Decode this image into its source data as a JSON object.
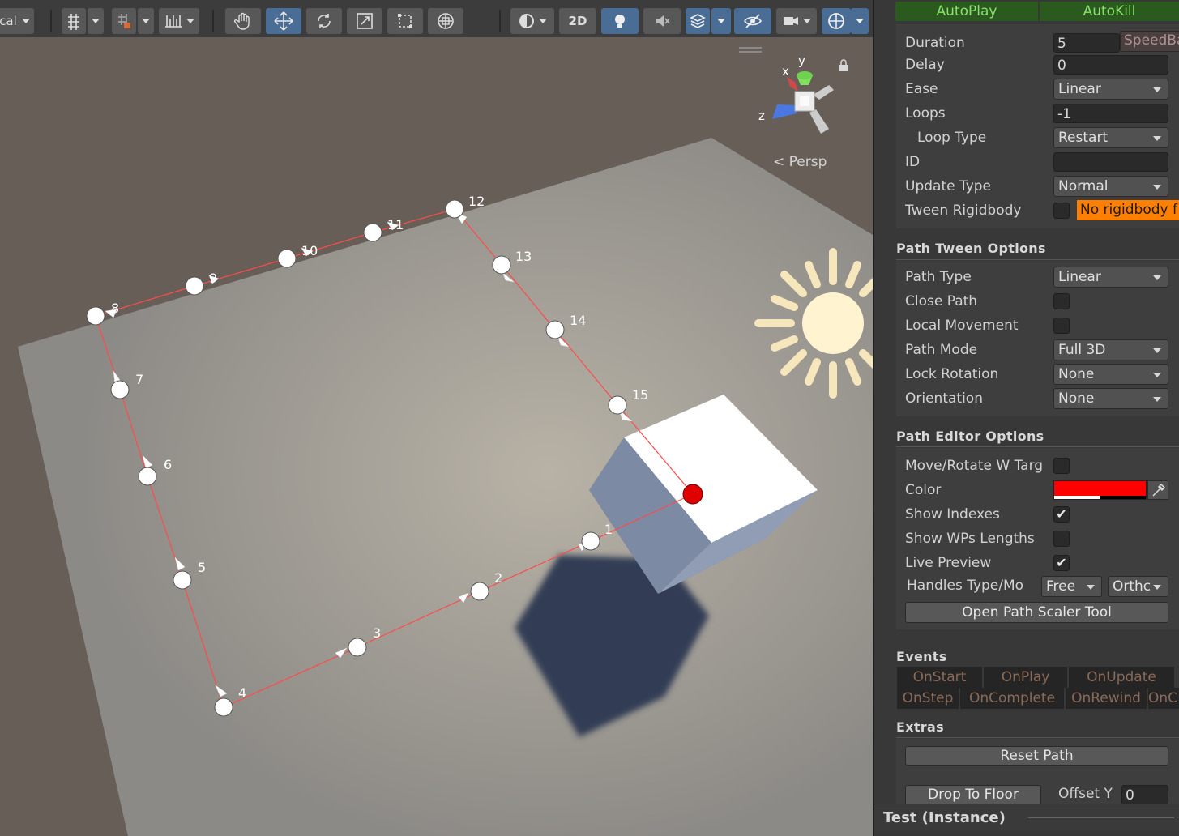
{
  "toolbar": {
    "left_label": "cal",
    "mode_2d": "2D"
  },
  "scene": {
    "projection_label": "< Persp",
    "gizmo_axes": {
      "x": "x",
      "y": "y",
      "z": "z"
    },
    "waypoint_indexes": [
      "1",
      "2",
      "3",
      "4",
      "5",
      "6",
      "7",
      "8",
      "9",
      "10",
      "11",
      "12",
      "13",
      "14",
      "15"
    ],
    "path_color": "#ff3030"
  },
  "inspector": {
    "autoplay_label": "AutoPlay",
    "autokill_label": "AutoKill",
    "duration_label": "Duration",
    "duration_value": "5",
    "speedbased_label": "SpeedBa",
    "delay_label": "Delay",
    "delay_value": "0",
    "ease_label": "Ease",
    "ease_value": "Linear",
    "loops_label": "Loops",
    "loops_value": "-1",
    "loop_type_label": "Loop Type",
    "loop_type_value": "Restart",
    "id_label": "ID",
    "id_value": "",
    "update_type_label": "Update Type",
    "update_type_value": "Normal",
    "tween_rigidbody_label": "Tween Rigidbody",
    "no_rigidbody_warning": "No rigidbody f",
    "path_tween_options_header": "Path Tween Options",
    "path_type_label": "Path Type",
    "path_type_value": "Linear",
    "close_path_label": "Close Path",
    "local_movement_label": "Local Movement",
    "path_mode_label": "Path Mode",
    "path_mode_value": "Full 3D",
    "lock_rotation_label": "Lock Rotation",
    "lock_rotation_value": "None",
    "orientation_label": "Orientation",
    "orientation_value": "None",
    "path_editor_options_header": "Path Editor Options",
    "move_rotate_label": "Move/Rotate W Targ",
    "color_label": "Color",
    "color_value": "#ff0000",
    "show_indexes_label": "Show Indexes",
    "show_indexes_checked": "✔",
    "show_wps_lengths_label": "Show WPs Lengths",
    "live_preview_label": "Live Preview",
    "live_preview_checked": "✔",
    "handles_type_label": "Handles Type/Mo",
    "handles_type_value": "Free",
    "handles_mode_value": "Orthc",
    "open_path_scaler_label": "Open Path Scaler Tool",
    "events_header": "Events",
    "events": [
      "OnStart",
      "OnPlay",
      "OnUpdate",
      "OnStep",
      "OnComplete",
      "OnRewind",
      "OnC"
    ],
    "extras_header": "Extras",
    "reset_path_label": "Reset Path",
    "drop_to_floor_label": "Drop To Floor",
    "offset_y_label": "Offset Y",
    "offset_y_value": "0",
    "footer_title": "Test (Instance)"
  }
}
